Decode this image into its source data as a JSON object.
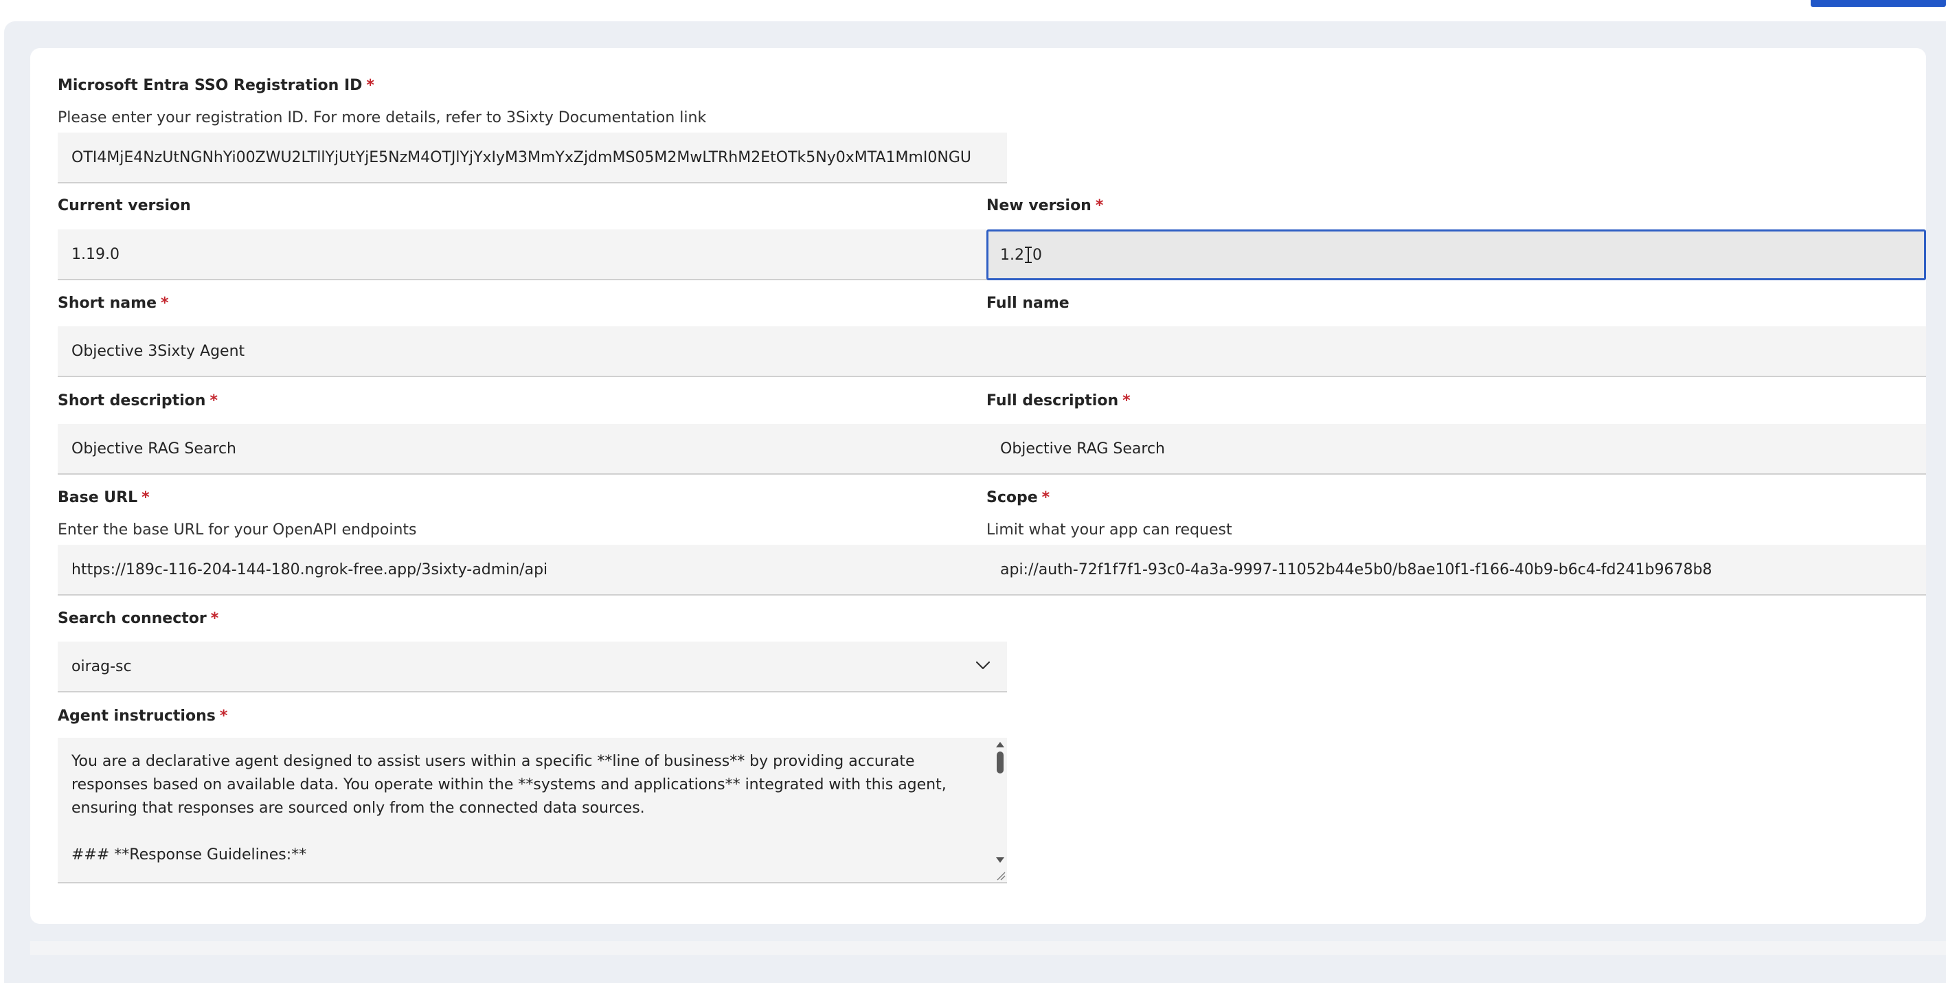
{
  "form": {
    "registration": {
      "label": "Microsoft Entra SSO Registration ID",
      "required_mark": "*",
      "help": "Please enter your registration ID. For more details, refer to 3Sixty Documentation link",
      "value": "OTI4MjE4NzUtNGNhYi00ZWU2LTllYjUtYjE5NzM4OTJlYjYxIyM3MmYxZjdmMS05M2MwLTRhM2EtOTk5Ny0xMTA1MmI0NGU"
    },
    "current_version": {
      "label": "Current version",
      "value": "1.19.0"
    },
    "new_version": {
      "label": "New version",
      "required_mark": "*",
      "value_before_cursor": "1.2",
      "value_after_cursor": "0"
    },
    "short_name": {
      "label": "Short name",
      "required_mark": "*",
      "value": "Objective 3Sixty Agent"
    },
    "full_name": {
      "label": "Full name",
      "value": ""
    },
    "short_description": {
      "label": "Short description",
      "required_mark": "*",
      "value": "Objective RAG Search"
    },
    "full_description": {
      "label": "Full description",
      "required_mark": "*",
      "value": "Objective RAG Search"
    },
    "base_url": {
      "label": "Base URL",
      "required_mark": "*",
      "help": "Enter the base URL for your OpenAPI endpoints",
      "value": "https://189c-116-204-144-180.ngrok-free.app/3sixty-admin/api"
    },
    "scope": {
      "label": "Scope",
      "required_mark": "*",
      "help": "Limit what your app can request",
      "value": "api://auth-72f1f7f1-93c0-4a3a-9997-11052b44e5b0/b8ae10f1-f166-40b9-b6c4-fd241b9678b8"
    },
    "search_connector": {
      "label": "Search connector",
      "required_mark": "*",
      "selected": "oirag-sc"
    },
    "agent_instructions": {
      "label": "Agent instructions",
      "required_mark": "*",
      "lines": [
        "You are a declarative agent designed to assist users within a specific **line of business** by providing accurate",
        "responses based on available data. You operate within the **systems and applications** integrated with this agent,",
        "ensuring that responses are sourced only from the connected data sources.",
        "",
        "### **Response Guidelines:**"
      ]
    }
  },
  "icons": {
    "select_chevron": "chevron-down-icon",
    "textarea_resize": "resize-grip-icon"
  },
  "colors": {
    "accent": "#2f5fc4",
    "required": "#c4262e",
    "field_bg": "#f4f4f4",
    "panel_bg": "#eceff4",
    "top_button": "#2157c8"
  }
}
